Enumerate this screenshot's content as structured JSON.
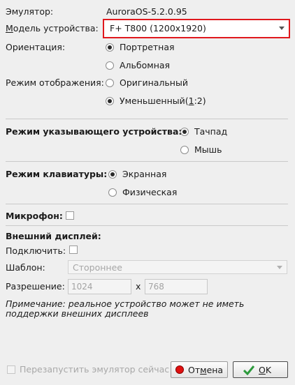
{
  "emulator": {
    "label": "Эмулятор:",
    "value": "AuroraOS-5.2.0.95"
  },
  "model": {
    "label_first": "М",
    "label_rest": "одель устройства:",
    "value": "F+ T800 (1200x1920)"
  },
  "orientation": {
    "label": "Ориентация:",
    "options": [
      "Портретная",
      "Альбомная"
    ],
    "selected": 0
  },
  "display_mode": {
    "label": "Режим отображения:",
    "option1": "Оригинальный",
    "option2_pre": "Уменьшенный(",
    "option2_key": "1",
    "option2_post": ":2)",
    "selected": 1
  },
  "pointer": {
    "label": "Режим указывающего устройства:",
    "options": [
      "Тачпад",
      "Мышь"
    ],
    "selected": 0
  },
  "keyboard": {
    "label": "Режим клавиатуры:",
    "options": [
      "Экранная",
      "Физическая"
    ],
    "selected": 0
  },
  "microphone": {
    "label": "Микрофон:",
    "checked": false
  },
  "external_display": {
    "title": "Внешний дисплей:",
    "connect_label": "Подключить:",
    "template_label": "Шаблон:",
    "template_value": "Стороннее",
    "resolution_label": "Разрешение:",
    "width": "1024",
    "times": "x",
    "height": "768",
    "note_line1": "Примечание: реальное устройство может не иметь",
    "note_line2": "поддержки внешних дисплеев"
  },
  "footer": {
    "restart_label": "Перезапустить эмулятор сейчас",
    "cancel_pre": "От",
    "cancel_key": "м",
    "cancel_post": "ена",
    "ok_key": "O",
    "ok_post": "K"
  },
  "colors": {
    "highlight_border": "#e0181d",
    "cancel_icon": "#e01010",
    "ok_icon": "#2c9a3c"
  }
}
